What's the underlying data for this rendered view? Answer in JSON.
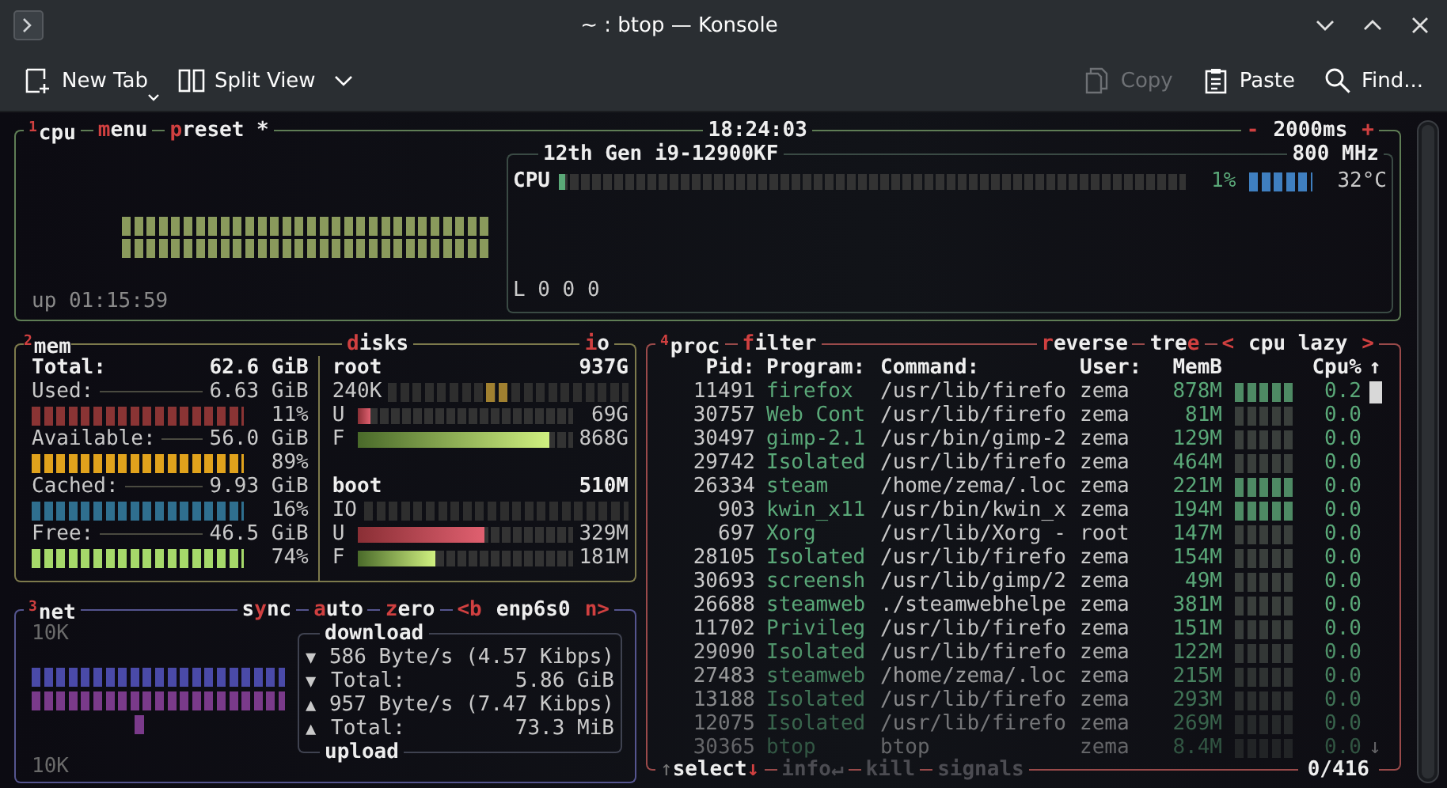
{
  "window": {
    "title": "~ : btop — Konsole"
  },
  "toolbar": {
    "left": [
      {
        "kind": "new-tab",
        "label": "New Tab",
        "disabled": false
      },
      {
        "kind": "split-view",
        "label": "Split View",
        "disabled": false
      }
    ],
    "right": [
      {
        "kind": "copy",
        "label": "Copy",
        "disabled": true
      },
      {
        "kind": "paste",
        "label": "Paste",
        "disabled": false
      },
      {
        "kind": "find",
        "label": "Find...",
        "disabled": false
      }
    ]
  },
  "cpu": {
    "title": "$^{1}$cpu",
    "menu": {
      "key": "m",
      "post": "enu"
    },
    "preset": {
      "key": "p",
      "post": "reset *"
    },
    "clock": "18:24:03",
    "interval": {
      "minus": "-",
      "value": "2000ms",
      "plus": "+"
    },
    "cpu_name": "12th Gen i9-12900KF",
    "frequency": "800 MHz",
    "meter": {
      "label": "CPU",
      "level": 0.01,
      "percent": "1%",
      "temperature": "32°C"
    },
    "load": "L 0 0 0",
    "uptime": "up 01:15:59"
  },
  "mem": {
    "title": "$^{2}$mem",
    "total": {
      "label": "Total:",
      "value": "62.6 GiB"
    },
    "rows": [
      {
        "label": "Used:",
        "value": "6.63 GiB",
        "percent": "11%",
        "color": "#8a3434"
      },
      {
        "label": "Available:",
        "value": "56.0 GiB",
        "percent": "89%",
        "color": "#e0a21c"
      },
      {
        "label": "Cached:",
        "value": "9.93 GiB",
        "percent": "16%",
        "color": "#2f6f8f"
      },
      {
        "label": "Free:",
        "value": "46.5 GiB",
        "percent": "74%",
        "color": "#a6d96a"
      }
    ]
  },
  "disks": {
    "button": {
      "key": "d",
      "post": "isks"
    },
    "io_button": {
      "key": "i",
      "post": "o"
    },
    "items": [
      {
        "name": "root",
        "size": "937G",
        "io_label": "240K",
        "used": {
          "label": "U",
          "level": 0.06,
          "value": "69G"
        },
        "free": {
          "label": "F",
          "level": 0.89,
          "value": "868G"
        }
      },
      {
        "name": "boot",
        "size": "510M",
        "io_label": "IO",
        "used": {
          "label": "U",
          "level": 0.59,
          "value": "329M"
        },
        "free": {
          "label": "F",
          "level": 0.36,
          "value": "181M"
        }
      }
    ]
  },
  "net": {
    "title": "$^{3}$net",
    "sync": {
      "pre": "s",
      "key": "y",
      "post": "nc"
    },
    "auto": {
      "key": "a",
      "post": "uto"
    },
    "zero": {
      "key": "z",
      "post": "ero"
    },
    "interface": {
      "prev": "<b",
      "name": "enp6s0",
      "next": "n>"
    },
    "scale_top": "10K",
    "scale_bottom": "10K",
    "download_label": "download",
    "upload_label": "upload",
    "rows": [
      {
        "kind": "rate",
        "arrow": "▼",
        "text": "586 Byte/s (4.57 Kibps)"
      },
      {
        "kind": "total",
        "arrow": "▼",
        "label": "Total:",
        "value": "5.86 GiB"
      },
      {
        "kind": "rate",
        "arrow": "▲",
        "text": "957 Byte/s (7.47 Kibps)"
      },
      {
        "kind": "total",
        "arrow": "▲",
        "label": "Total:",
        "value": "73.3 MiB"
      }
    ]
  },
  "proc": {
    "title": "$^{4}$proc",
    "filter": {
      "key": "f",
      "post": "ilter"
    },
    "reverse": {
      "key": "r",
      "post": "everse"
    },
    "tree": {
      "pre": "tre",
      "key": "e"
    },
    "sort": {
      "prev": "<",
      "label": "cpu lazy",
      "next": ">"
    },
    "columns": [
      "Pid:",
      "Program:",
      "Command:",
      "User:",
      "MemB",
      "Cpu%"
    ],
    "scroll_up": "↑",
    "scroll_down": "↓",
    "rows": [
      {
        "pid": "11491",
        "program": "firefox",
        "command": "/usr/lib/firefo",
        "user": "zema",
        "mem": "878M",
        "cpu": "0.2"
      },
      {
        "pid": "30757",
        "program": "Web Cont",
        "command": "/usr/lib/firefo",
        "user": "zema",
        "mem": "81M",
        "cpu": "0.0"
      },
      {
        "pid": "30497",
        "program": "gimp-2.1",
        "command": "/usr/bin/gimp-2",
        "user": "zema",
        "mem": "129M",
        "cpu": "0.0"
      },
      {
        "pid": "29742",
        "program": "Isolated",
        "command": "/usr/lib/firefo",
        "user": "zema",
        "mem": "464M",
        "cpu": "0.0"
      },
      {
        "pid": "26334",
        "program": "steam",
        "command": "/home/zema/.loc",
        "user": "zema",
        "mem": "221M",
        "cpu": "0.0"
      },
      {
        "pid": "903",
        "program": "kwin_x11",
        "command": "/usr/bin/kwin_x",
        "user": "zema",
        "mem": "194M",
        "cpu": "0.0"
      },
      {
        "pid": "697",
        "program": "Xorg",
        "command": "/usr/lib/Xorg -",
        "user": "root",
        "mem": "147M",
        "cpu": "0.0"
      },
      {
        "pid": "28105",
        "program": "Isolated",
        "command": "/usr/lib/firefo",
        "user": "zema",
        "mem": "154M",
        "cpu": "0.0"
      },
      {
        "pid": "30693",
        "program": "screensh",
        "command": "/usr/lib/gimp/2",
        "user": "zema",
        "mem": "49M",
        "cpu": "0.0"
      },
      {
        "pid": "26688",
        "program": "steamweb",
        "command": "./steamwebhelpe",
        "user": "zema",
        "mem": "381M",
        "cpu": "0.0"
      },
      {
        "pid": "11702",
        "program": "Privileg",
        "command": "/usr/lib/firefo",
        "user": "zema",
        "mem": "151M",
        "cpu": "0.0"
      },
      {
        "pid": "29090",
        "program": "Isolated",
        "command": "/usr/lib/firefo",
        "user": "zema",
        "mem": "122M",
        "cpu": "0.0"
      },
      {
        "pid": "27483",
        "program": "steamweb",
        "command": "/home/zema/.loc",
        "user": "zema",
        "mem": "215M",
        "cpu": "0.0"
      },
      {
        "pid": "13188",
        "program": "Isolated",
        "command": "/usr/lib/firefo",
        "user": "zema",
        "mem": "293M",
        "cpu": "0.0"
      },
      {
        "pid": "12075",
        "program": "Isolated",
        "command": "/usr/lib/firefo",
        "user": "zema",
        "mem": "269M",
        "cpu": "0.0"
      },
      {
        "pid": "30365",
        "program": "btop",
        "command": "btop",
        "user": "zema",
        "mem": "8.4M",
        "cpu": "0.0"
      }
    ],
    "footer": [
      {
        "pre": "↑",
        "label": "select",
        "post": "↓",
        "disabled": false
      },
      {
        "label": "info",
        "post": "↵",
        "disabled": true
      },
      {
        "label": "kill",
        "disabled": true
      },
      {
        "label": "signals",
        "disabled": true
      }
    ],
    "count": "0/416"
  }
}
